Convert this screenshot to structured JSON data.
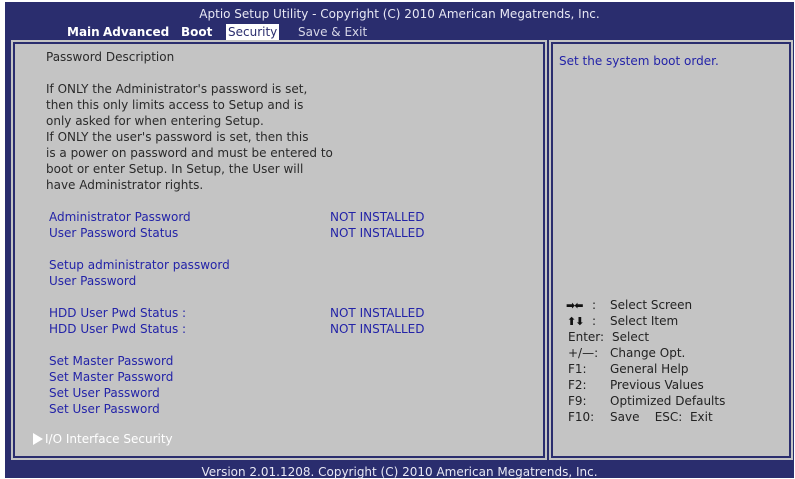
{
  "header": {
    "title": "Aptio Setup Utility - Copyright (C) 2010 American Megatrends, Inc."
  },
  "menu": [
    "Main",
    "Advanced",
    "Boot",
    "Security",
    "Save & Exit"
  ],
  "description": {
    "heading": "Password Description",
    "lines": [
      "If ONLY the Administrator's password is set,",
      "then this only limits access to Setup and is",
      "only asked for when entering Setup.",
      "If ONLY the user's password is set, then this",
      "is a power on password and must be entered to",
      "boot or enter Setup. In Setup, the User will",
      "have Administrator rights."
    ]
  },
  "status": [
    {
      "label": "Administrator Password",
      "value": "NOT INSTALLED"
    },
    {
      "label": "User Password Status",
      "value": "NOT INSTALLED"
    }
  ],
  "setup": [
    "Setup administrator password",
    "User Password"
  ],
  "hdd": [
    {
      "label": "HDD User Pwd Status :",
      "value": "NOT INSTALLED"
    },
    {
      "label": "HDD User Pwd Status :",
      "value": "NOT INSTALLED"
    }
  ],
  "set_items": [
    "Set Master Password",
    "Set Master Password",
    "Set User Password",
    "Set User Password"
  ],
  "submenu": "I/O Interface Security",
  "help": {
    "text": "Set the system boot order.",
    "keys": [
      {
        "key": ":",
        "action": "Select Screen",
        "icon": "left-right-arrows-icon"
      },
      {
        "key": ":",
        "action": "Select Item",
        "icon": "up-down-arrows-icon"
      },
      {
        "key": "Enter:",
        "action": "Select"
      },
      {
        "key": "+/—:",
        "action": "Change Opt."
      },
      {
        "key": "F1:",
        "action": "General Help"
      },
      {
        "key": "F2:",
        "action": "Previous Values"
      },
      {
        "key": "F9:",
        "action": "Optimized Defaults"
      },
      {
        "key": "F10:",
        "action": "Save    ESC:  Exit"
      }
    ]
  },
  "footer": "Version 2.01.1208. Copyright (C) 2010 American Megatrends, Inc.",
  "colors": {
    "background": "#2a2d6e",
    "panel": "#c4c4c4",
    "link": "#2323a8"
  }
}
